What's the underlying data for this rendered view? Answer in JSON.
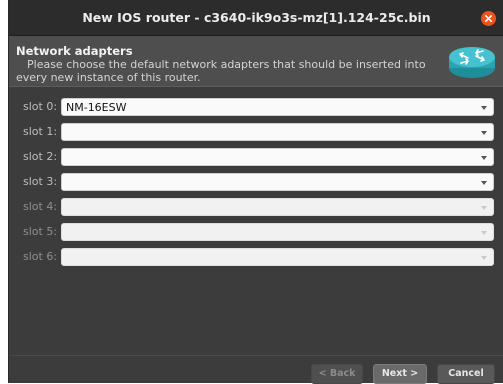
{
  "window": {
    "title": "New IOS router - c3640-ik9o3s-mz[1].124-25c.bin"
  },
  "header": {
    "title": "Network adapters",
    "description": "Please choose the default network adapters that should be inserted into every new instance of this router."
  },
  "slots": [
    {
      "label": "slot 0:",
      "value": "NM-16ESW",
      "enabled": true
    },
    {
      "label": "slot 1:",
      "value": "",
      "enabled": true
    },
    {
      "label": "slot 2:",
      "value": "",
      "enabled": true
    },
    {
      "label": "slot 3:",
      "value": "",
      "enabled": true
    },
    {
      "label": "slot 4:",
      "value": "",
      "enabled": false
    },
    {
      "label": "slot 5:",
      "value": "",
      "enabled": false
    },
    {
      "label": "slot 6:",
      "value": "",
      "enabled": false
    }
  ],
  "buttons": {
    "back": "< Back",
    "next": "Next >",
    "cancel": "Cancel"
  },
  "icons": {
    "close": "close-icon",
    "router": "router-icon",
    "dropdown": "chevron-down-icon"
  },
  "colors": {
    "accent": "#e95420",
    "router_icon": "#38b6c4"
  }
}
